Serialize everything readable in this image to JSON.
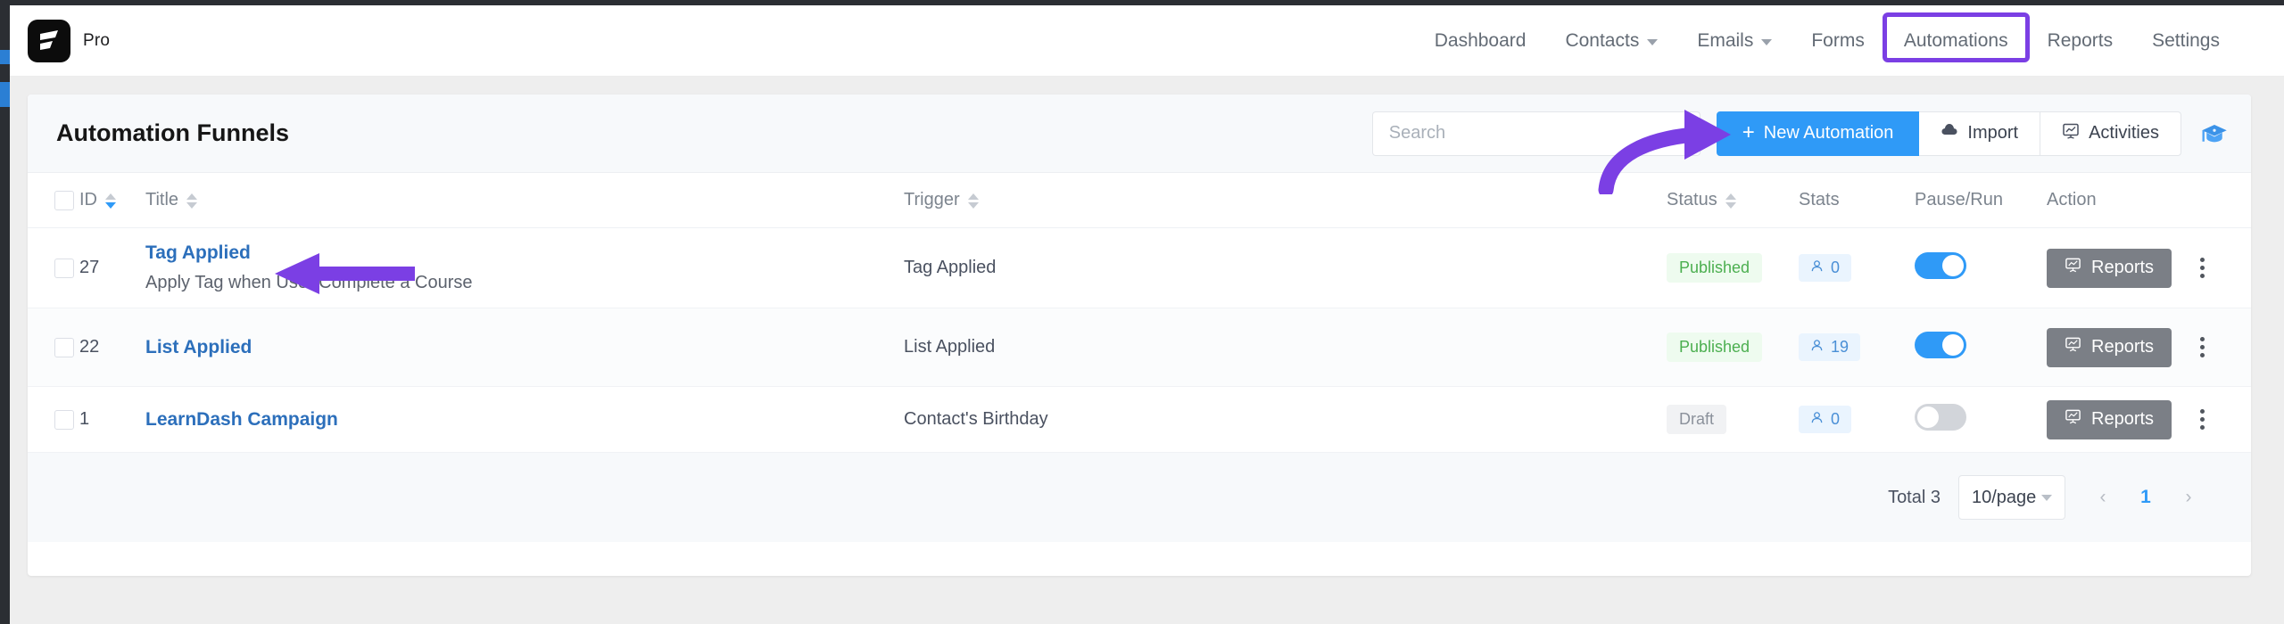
{
  "header": {
    "brand_name": "Pro",
    "logo_icon": "fluentcrm-logo-icon",
    "nav": [
      {
        "label": "Dashboard",
        "has_caret": false,
        "active": false
      },
      {
        "label": "Contacts",
        "has_caret": true,
        "active": false
      },
      {
        "label": "Emails",
        "has_caret": true,
        "active": false
      },
      {
        "label": "Forms",
        "has_caret": false,
        "active": false
      },
      {
        "label": "Automations",
        "has_caret": false,
        "active": true
      },
      {
        "label": "Reports",
        "has_caret": false,
        "active": false
      },
      {
        "label": "Settings",
        "has_caret": false,
        "active": false
      }
    ]
  },
  "card": {
    "title": "Automation Funnels",
    "search": {
      "value": "",
      "placeholder": "Search"
    },
    "buttons": {
      "new_automation": "New Automation",
      "new_automation_icon": "plus-icon",
      "import": "Import",
      "import_icon": "cloud-upload-icon",
      "activities": "Activities",
      "activities_icon": "presentation-chart-icon",
      "academy_icon": "graduation-cap-icon"
    }
  },
  "table": {
    "columns": {
      "select": "",
      "id": "ID",
      "title": "Title",
      "trigger": "Trigger",
      "status": "Status",
      "stats": "Stats",
      "pause_run": "Pause/Run",
      "action": "Action"
    },
    "sort": {
      "id": "desc",
      "title": "none",
      "trigger": "none",
      "status": "none"
    },
    "rows": [
      {
        "id": "27",
        "title": "Tag Applied",
        "subtitle": "Apply Tag when User Complete a Course",
        "trigger": "Tag Applied",
        "status": "Published",
        "status_kind": "published",
        "stats": "0",
        "stats_icon": "user-icon",
        "toggle": "on",
        "action_label": "Reports",
        "action_icon": "presentation-chart-icon",
        "menu_icon": "kebab-menu-icon"
      },
      {
        "id": "22",
        "title": "List Applied",
        "subtitle": "",
        "trigger": "List Applied",
        "status": "Published",
        "status_kind": "published",
        "stats": "19",
        "stats_icon": "user-icon",
        "toggle": "on",
        "action_label": "Reports",
        "action_icon": "presentation-chart-icon",
        "menu_icon": "kebab-menu-icon"
      },
      {
        "id": "1",
        "title": "LearnDash Campaign",
        "subtitle": "",
        "trigger": "Contact's Birthday",
        "status": "Draft",
        "status_kind": "draft",
        "stats": "0",
        "stats_icon": "user-icon",
        "toggle": "off",
        "action_label": "Reports",
        "action_icon": "presentation-chart-icon",
        "menu_icon": "kebab-menu-icon"
      }
    ]
  },
  "footer": {
    "total": "Total 3",
    "page_size": "10/page",
    "prev": "‹",
    "current_page": "1",
    "next": "›"
  },
  "annotations": {
    "accent_purple": "#7b3fe4",
    "arrow_to_title": "left-pointing-arrow",
    "arrow_to_new_automation": "curved-right-pointing-arrow",
    "highlight_nav": "Automations"
  },
  "colors": {
    "primary_blue": "#2f9af7",
    "link_blue": "#2c6fbb",
    "published_green": "#4caf50",
    "rail_dark": "#2b2e33"
  }
}
